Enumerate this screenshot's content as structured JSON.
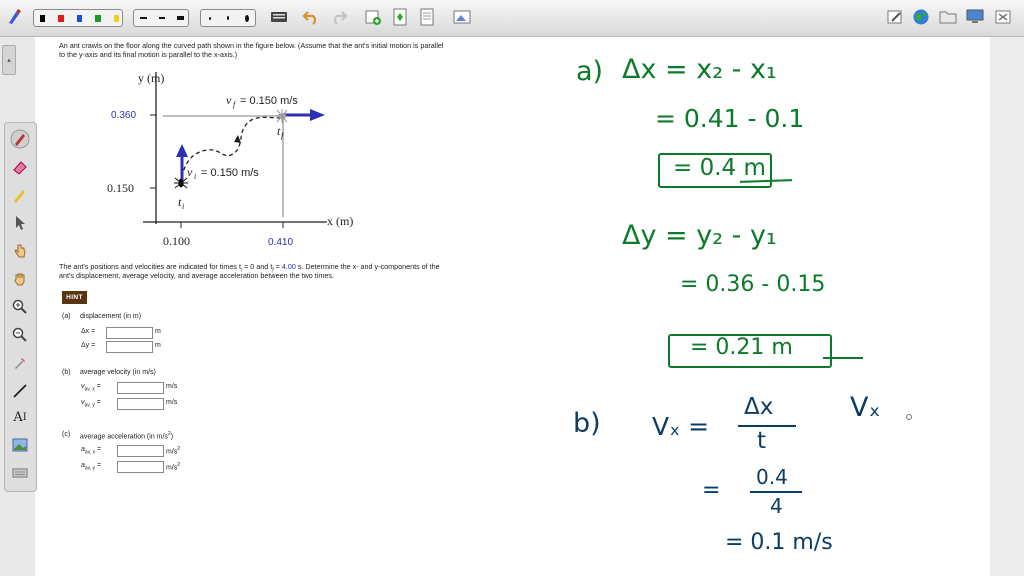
{
  "toolbar": {
    "colors": [
      "#000000",
      "#e01b1b",
      "#1c4fd8",
      "#1a9a2a",
      "#f1d21a"
    ],
    "line_styles": [
      "dash",
      "dash",
      "solid"
    ],
    "point_sizes": [
      "small",
      "medium",
      "large"
    ],
    "icons": [
      "pen-logo-icon",
      "keyboard-icon",
      "undo-icon",
      "redo-icon",
      "new-page-icon",
      "insert-page-icon",
      "page-icon",
      "image-icon",
      "edit-icon",
      "globe-icon",
      "folder-icon",
      "monitor-icon",
      "close-icon"
    ]
  },
  "problem": {
    "intro_line1": "An ant crawls on the floor along the curved path shown in the figure below. (Assume that the ant's initial motion is parallel",
    "intro_line2": "to the y-axis and its final motion is parallel to the x-axis.)",
    "figure": {
      "y_axis_label": "y (m)",
      "x_axis_label": "x (m)",
      "y_tick_high": "0.360",
      "y_tick_low": "0.150",
      "x_tick_left": "0.100",
      "x_tick_right": "0.410",
      "vf_label": "v",
      "vf_sub": "f",
      "vf_value": "= 0.150 m/s",
      "vi_label": "v",
      "vi_sub": "i",
      "vi_value": "= 0.150 m/s",
      "ti_label": "t",
      "ti_sub": "i",
      "tf_label": "t",
      "tf_sub": "f",
      "accent_color": "#2b2fb5"
    },
    "desc_line1_a": "The ant's positions and velocities are indicated for times t",
    "desc_line1_b": " = 0 and t",
    "desc_line1_tf_value": "4.00",
    "desc_line1_c": " s. Determine the x- and y-components of the",
    "desc_line2": "ant's displacement, average velocity, and average acceleration between the two times.",
    "hint_label": "HINT",
    "parts": {
      "a_label": "(a)",
      "a_title": "displacement (in m)",
      "a_dx": "Δx =",
      "a_dy": "Δy =",
      "a_unit": "m",
      "b_label": "(b)",
      "b_title": "average velocity (in m/s)",
      "b_vx": "v",
      "b_vx_sub": "av, x",
      "b_vy": "v",
      "b_vy_sub": "av, y",
      "b_unit": "m/s",
      "c_label": "(c)",
      "c_title": "average acceleration (in m/s",
      "c_title_sup": "2",
      "c_title_end": ")",
      "c_ax": "a",
      "c_ax_sub": "av, x",
      "c_ay": "a",
      "c_ay_sub": "av, y",
      "c_unit": "m/s",
      "c_unit_sup": "2",
      "eq": "="
    }
  },
  "handwriting": {
    "a_label": "a)",
    "a_line1": "Δx = x₂ - x₁",
    "a_line2": "= 0.41 - 0.1",
    "a_line3": "= 0.4 m",
    "a_line4": "Δy = y₂ - y₁",
    "a_line5": "= 0.36 - 0.15",
    "a_line6": "= 0.21 m",
    "b_label": "b)",
    "b_vx": "Vₓ =",
    "b_num": "Δx",
    "b_den": "t",
    "b_vx2": "Vₓ",
    "b_line2_eq": "=",
    "b_line2_num": "0.4",
    "b_line2_den": "4",
    "b_line3": "= 0.1 m/s"
  }
}
